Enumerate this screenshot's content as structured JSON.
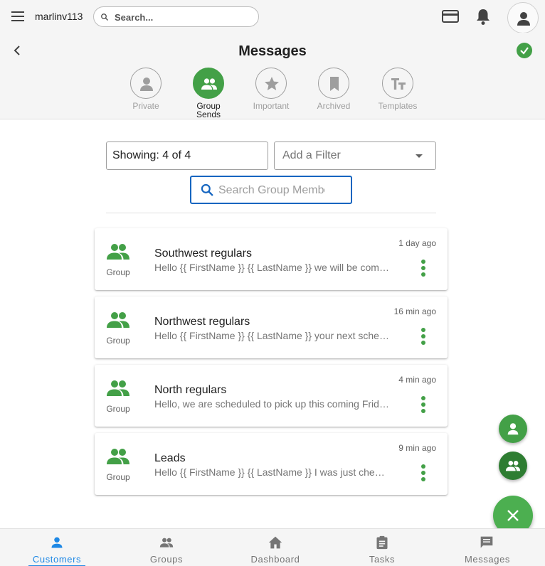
{
  "topbar": {
    "username": "marlinv113",
    "search_placeholder": "Search...",
    "icons": [
      "menu-icon",
      "search-icon",
      "credit-card-icon",
      "bell-icon",
      "account-icon"
    ]
  },
  "header": {
    "title": "Messages",
    "categories": [
      {
        "label": "Private",
        "icon": "person-icon",
        "active": false
      },
      {
        "label_line1": "Group",
        "label_line2": "Sends",
        "icon": "group-icon",
        "active": true
      },
      {
        "label": "Important",
        "icon": "star-icon",
        "active": false
      },
      {
        "label": "Archived",
        "icon": "bookmark-icon",
        "active": false
      },
      {
        "label": "Templates",
        "icon": "text-format-icon",
        "active": false
      }
    ]
  },
  "filters": {
    "showing": "Showing: 4 of 4",
    "filter_placeholder": "Add a Filter",
    "member_search_placeholder": "Search Group Members"
  },
  "messages": [
    {
      "type_label": "Group",
      "title": "Southwest regulars",
      "preview": "Hello {{ FirstName }} {{ LastName }} we will be coming by next week",
      "time": "1 day ago"
    },
    {
      "type_label": "Group",
      "title": "Northwest regulars",
      "preview": "Hello {{ FirstName }} {{ LastName }} your next scheduled pickup is",
      "time": "16 min ago"
    },
    {
      "type_label": "Group",
      "title": "North regulars",
      "preview": "Hello, we are scheduled to pick up this coming Friday morning",
      "time": "4 min ago"
    },
    {
      "type_label": "Group",
      "title": "Leads",
      "preview": "Hello {{ FirstName }} {{ LastName }} I was just checking in with you",
      "time": "9 min ago"
    }
  ],
  "bottom_nav": [
    {
      "label": "Customers",
      "icon": "person-icon",
      "active": true
    },
    {
      "label": "Groups",
      "icon": "group-icon",
      "active": false
    },
    {
      "label": "Dashboard",
      "icon": "home-icon",
      "active": false
    },
    {
      "label": "Tasks",
      "icon": "clipboard-icon",
      "active": false
    },
    {
      "label": "Messages",
      "icon": "chat-icon",
      "active": false
    }
  ],
  "colors": {
    "accent_green": "#43a047",
    "nav_active_blue": "#1e88e5",
    "fab_dark_green": "#2e7d32"
  }
}
